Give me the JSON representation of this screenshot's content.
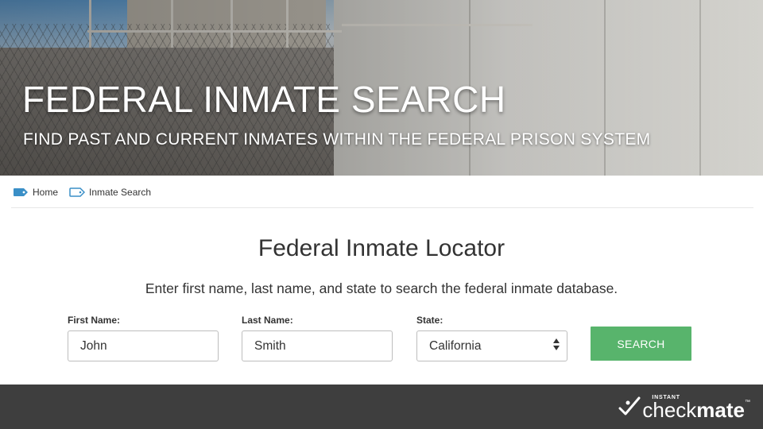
{
  "hero": {
    "title": "FEDERAL INMATE SEARCH",
    "subtitle": "FIND PAST AND CURRENT INMATES WITHIN THE FEDERAL PRISON SYSTEM"
  },
  "breadcrumb": {
    "items": [
      {
        "label": "Home",
        "icon": "tag-filled-icon"
      },
      {
        "label": "Inmate Search",
        "icon": "tag-outline-icon"
      }
    ]
  },
  "locator": {
    "title": "Federal Inmate Locator",
    "description": "Enter first name, last name, and state to search the federal inmate database."
  },
  "form": {
    "first_name": {
      "label": "First Name:",
      "value": "John"
    },
    "last_name": {
      "label": "Last Name:",
      "value": "Smith"
    },
    "state": {
      "label": "State:",
      "value": "California"
    },
    "search_label": "SEARCH"
  },
  "footer": {
    "brand_prefix": "INSTANT",
    "brand_check": "check",
    "brand_mate": "mate",
    "brand_tm": "™"
  },
  "colors": {
    "accent_green": "#58b46c",
    "breadcrumb_blue": "#3a8fc7",
    "footer_bg": "#3e3e3e"
  }
}
